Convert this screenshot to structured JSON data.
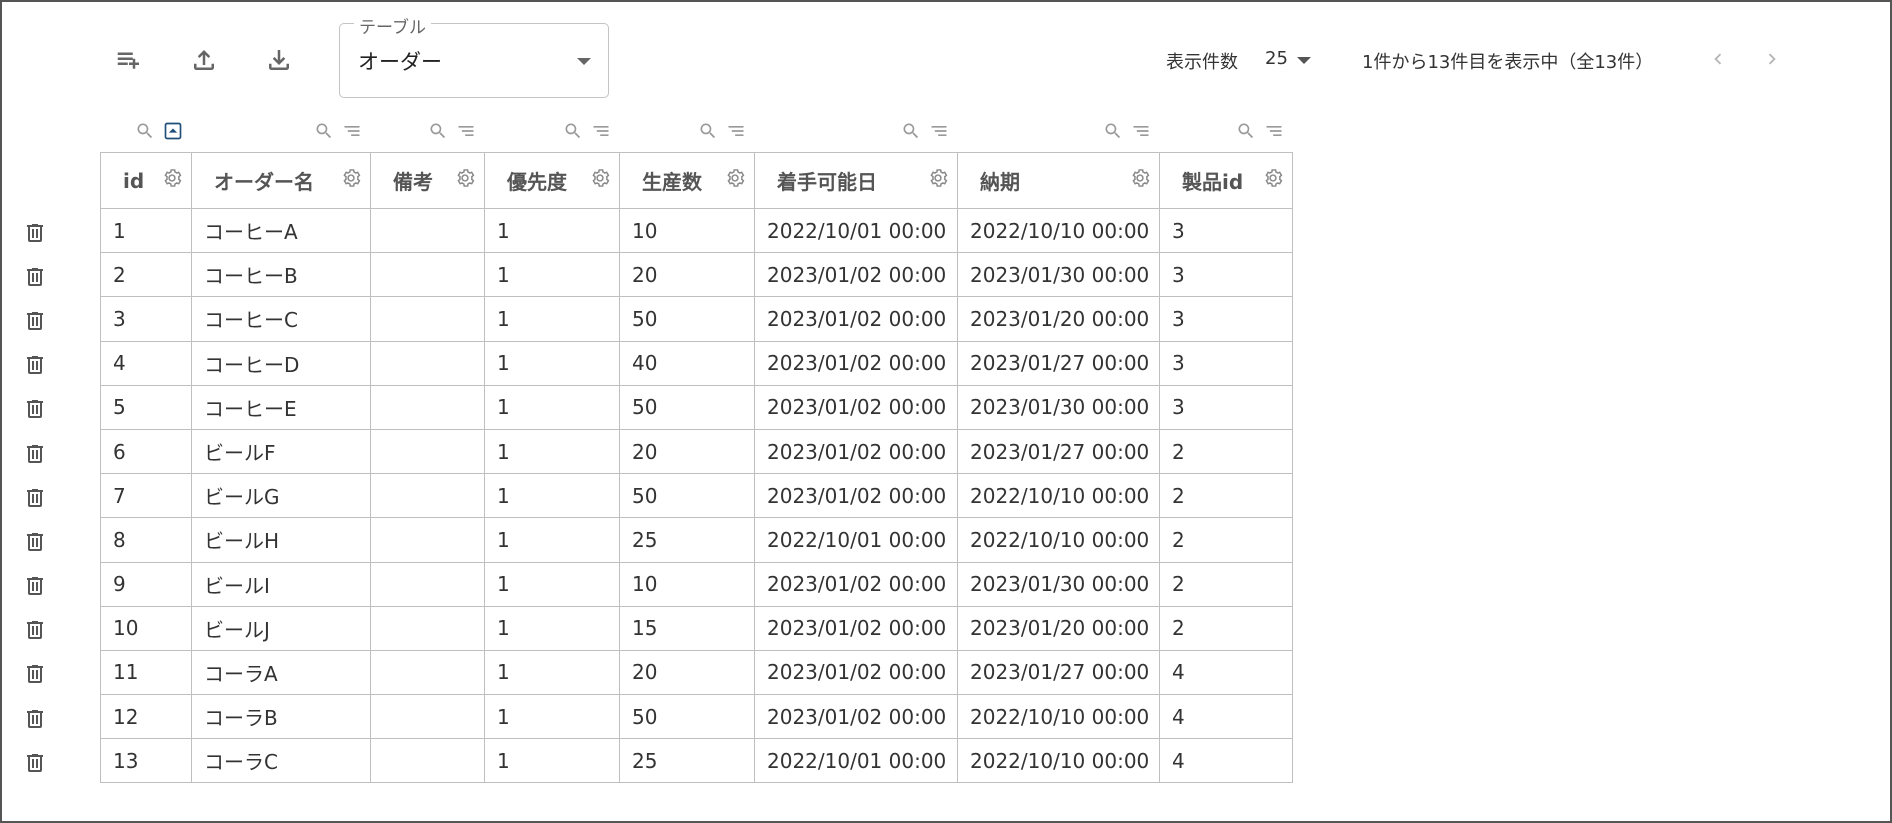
{
  "toolbar": {
    "add_row_icon": "playlist-add-icon",
    "export_icon": "upload-icon",
    "import_icon": "download-icon",
    "table_select": {
      "legend": "テーブル",
      "value": "オーダー"
    },
    "rows_per_page_label": "表示件数",
    "rows_per_page_value": "25",
    "range_text": "1件から13件目を表示中（全13件）"
  },
  "table": {
    "columns": [
      {
        "label": "id",
        "key": "id"
      },
      {
        "label": "オーダー名",
        "key": "name"
      },
      {
        "label": "備考",
        "key": "note"
      },
      {
        "label": "優先度",
        "key": "priority"
      },
      {
        "label": "生産数",
        "key": "quantity"
      },
      {
        "label": "着手可能日",
        "key": "start"
      },
      {
        "label": "納期",
        "key": "due"
      },
      {
        "label": "製品id",
        "key": "product_id"
      }
    ],
    "rows": [
      [
        "1",
        "コーヒーA",
        "",
        "1",
        "10",
        "2022/10/01 00:00",
        "2022/10/10 00:00",
        "3"
      ],
      [
        "2",
        "コーヒーB",
        "",
        "1",
        "20",
        "2023/01/02 00:00",
        "2023/01/30 00:00",
        "3"
      ],
      [
        "3",
        "コーヒーC",
        "",
        "1",
        "50",
        "2023/01/02 00:00",
        "2023/01/20 00:00",
        "3"
      ],
      [
        "4",
        "コーヒーD",
        "",
        "1",
        "40",
        "2023/01/02 00:00",
        "2023/01/27 00:00",
        "3"
      ],
      [
        "5",
        "コーヒーE",
        "",
        "1",
        "50",
        "2023/01/02 00:00",
        "2023/01/30 00:00",
        "3"
      ],
      [
        "6",
        "ビールF",
        "",
        "1",
        "20",
        "2023/01/02 00:00",
        "2023/01/27 00:00",
        "2"
      ],
      [
        "7",
        "ビールG",
        "",
        "1",
        "50",
        "2023/01/02 00:00",
        "2022/10/10 00:00",
        "2"
      ],
      [
        "8",
        "ビールH",
        "",
        "1",
        "25",
        "2022/10/01 00:00",
        "2022/10/10 00:00",
        "2"
      ],
      [
        "9",
        "ビールI",
        "",
        "1",
        "10",
        "2023/01/02 00:00",
        "2023/01/30 00:00",
        "2"
      ],
      [
        "10",
        "ビールJ",
        "",
        "1",
        "15",
        "2023/01/02 00:00",
        "2023/01/20 00:00",
        "2"
      ],
      [
        "11",
        "コーラA",
        "",
        "1",
        "20",
        "2023/01/02 00:00",
        "2023/01/27 00:00",
        "4"
      ],
      [
        "12",
        "コーラB",
        "",
        "1",
        "50",
        "2023/01/02 00:00",
        "2022/10/10 00:00",
        "4"
      ],
      [
        "13",
        "コーラC",
        "",
        "1",
        "25",
        "2022/10/01 00:00",
        "2022/10/10 00:00",
        "4"
      ]
    ]
  },
  "colors": {
    "border": "#bfbfbf",
    "icon": "#666666",
    "active_toggle": "#1f4e79"
  }
}
